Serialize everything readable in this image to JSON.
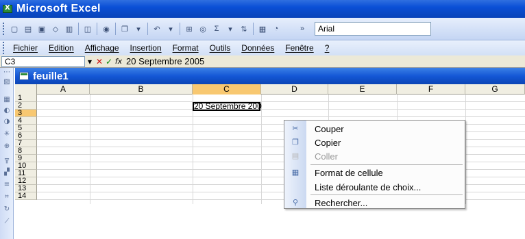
{
  "window": {
    "title": "Microsoft Excel"
  },
  "toolbar": {
    "font_name": "Arial"
  },
  "menu": [
    "Fichier",
    "Edition",
    "Affichage",
    "Insertion",
    "Format",
    "Outils",
    "Données",
    "Fenêtre",
    "?"
  ],
  "formula_bar": {
    "cell_ref": "C3",
    "cancel": "✕",
    "enter": "✓",
    "fx": "fx",
    "content": "20 Septembre 2005"
  },
  "sheet": {
    "title": "feuille1",
    "columns": [
      "A",
      "B",
      "C",
      "D",
      "E",
      "F",
      "G"
    ],
    "rows": [
      "1",
      "2",
      "3",
      "4",
      "5",
      "6",
      "7",
      "8",
      "9",
      "10",
      "11",
      "12",
      "13",
      "14"
    ],
    "selected_cell_text": "20 Septembre 200",
    "selected_column": "C",
    "selected_row": "3"
  },
  "context_menu": {
    "items": [
      {
        "label": "Couper",
        "icon": "scissors-icon",
        "disabled": false
      },
      {
        "label": "Copier",
        "icon": "copy-icon",
        "disabled": false
      },
      {
        "label": "Coller",
        "icon": "paste-icon",
        "disabled": true
      },
      {
        "label": "Format de cellule",
        "icon": "format-cell-icon",
        "disabled": false
      },
      {
        "label": "Liste déroulante de choix...",
        "icon": "",
        "disabled": false
      },
      {
        "label": "Rechercher...",
        "icon": "search-binoculars-icon",
        "disabled": false
      }
    ]
  },
  "colors": {
    "title_bar": "#0a4fd6",
    "selection_header": "#f8c871",
    "toolbar_bg": "#c4d5f3"
  }
}
